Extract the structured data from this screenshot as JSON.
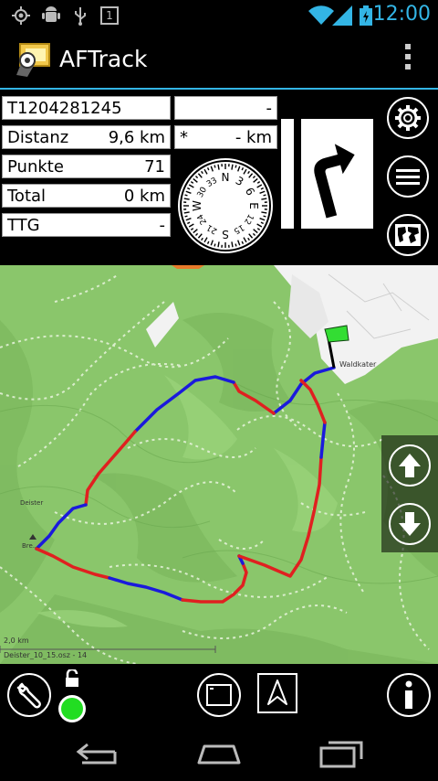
{
  "status": {
    "time": "12:00",
    "notification_count": "1"
  },
  "app": {
    "title": "AFTrack"
  },
  "fields": {
    "track_id": "T1204281245",
    "top_right_value": "-",
    "distanz_label": "Distanz",
    "distanz_value": "9,6 km",
    "star_label": "*",
    "star_value": "- km",
    "punkte_label": "Punkte",
    "punkte_value": "71",
    "total_label": "Total",
    "total_value": "0 km",
    "ttg_label": "TTG",
    "ttg_value": "-"
  },
  "compass": {
    "labels": [
      "N",
      "3",
      "6",
      "E",
      "12",
      "15",
      "S",
      "21",
      "24",
      "W",
      "30",
      "33"
    ]
  },
  "map": {
    "place_waldkater": "Waldkater",
    "place_deister": "Deister",
    "place_bre": "Bre...",
    "scale_label": "2,0 km",
    "map_file": "Deister_10_15.osz - 14"
  },
  "colors": {
    "accent": "#33b5e5",
    "track_red": "#e02020",
    "track_blue": "#1a1adc",
    "map_green": "#8ac66b",
    "flag_green": "#33dd33",
    "status_dot": "#22dd22"
  },
  "icons": {
    "settings": "gear-icon",
    "menu": "list-icon",
    "map": "globe-icon",
    "up": "arrow-up-icon",
    "down": "arrow-down-icon",
    "tools": "wrench-icon",
    "lock": "lock-open-icon",
    "window": "window-icon",
    "north": "north-arrow-icon",
    "info": "info-icon"
  }
}
